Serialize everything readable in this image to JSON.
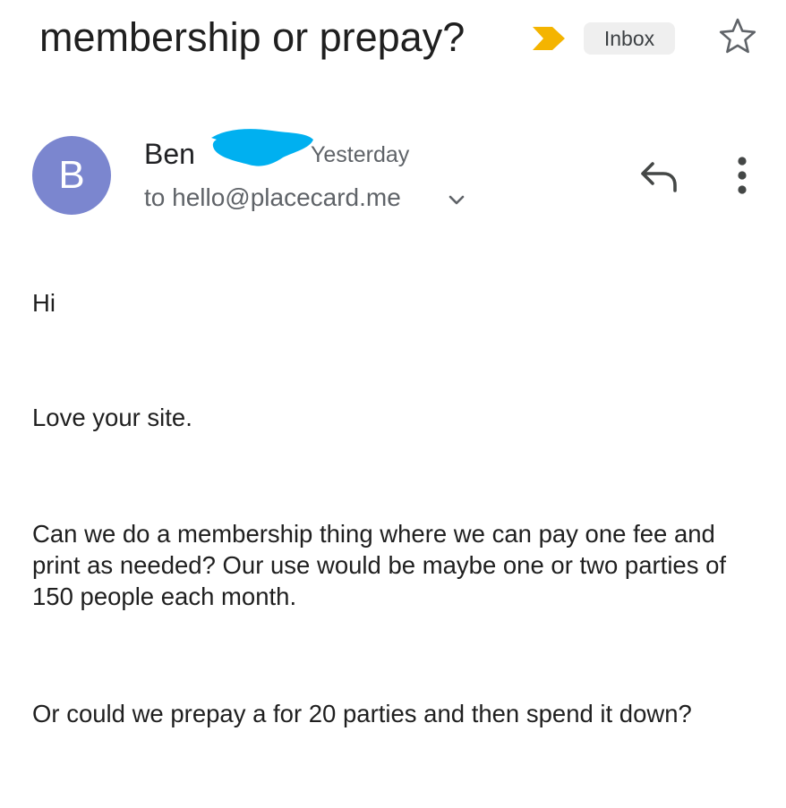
{
  "email": {
    "subject": "membership or prepay?",
    "label_chip": "Inbox",
    "importance_color": "#f4b400",
    "sender": {
      "initial": "B",
      "name": "Ben",
      "date": "Yesterday",
      "recipient": "to hello@placecard.me",
      "avatar_color": "#7b86cf"
    },
    "body": [
      "Hi",
      "Love your site.",
      "Can we do a membership thing where we can pay one fee and print as needed?  Our use would be maybe one or two parties of 150 people each month.",
      "Or could we prepay a for 20 parties and then spend it down?"
    ]
  },
  "icons": {
    "importance": "importance-marker-icon",
    "star": "star-outline-icon",
    "details": "chevron-down-icon",
    "reply": "reply-icon",
    "more": "more-vertical-icon"
  },
  "redaction_color": "#00b0f0"
}
